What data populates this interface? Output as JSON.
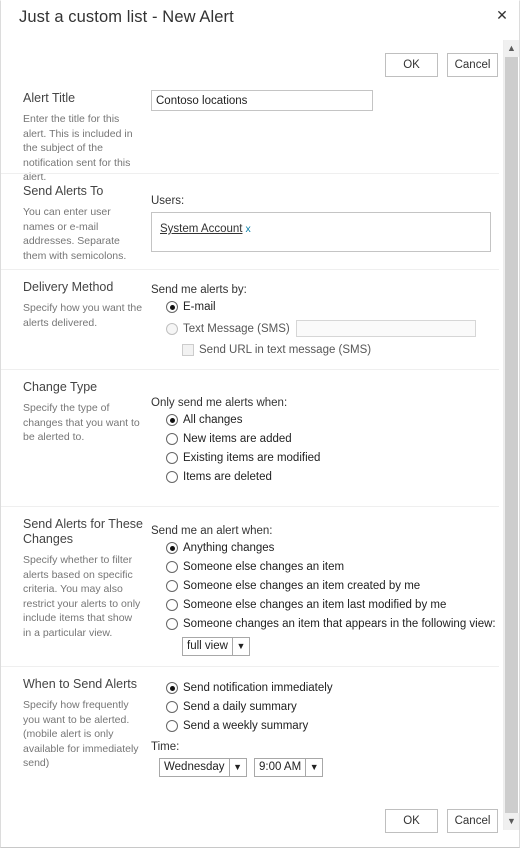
{
  "dialog": {
    "title": "Just a custom list - New Alert",
    "close_icon": "close-icon"
  },
  "actions": {
    "ok_label": "OK",
    "cancel_label": "Cancel"
  },
  "scrollbar": {
    "up_icon": "chevron-up-icon",
    "down_icon": "chevron-down-icon"
  },
  "sections": {
    "alert_title": {
      "title": "Alert Title",
      "description": "Enter the title for this alert. This is included in the subject of the notification sent for this alert.",
      "input_value": "Contoso locations",
      "input_placeholder": ""
    },
    "send_alerts_to": {
      "title": "Send Alerts To",
      "description": "You can enter user names or e-mail addresses. Separate them with semicolons.",
      "users_caption": "Users:",
      "user_name": "System Account",
      "user_remove_label": "x",
      "user_remove_color": "#0b7fa8"
    },
    "delivery_method": {
      "title": "Delivery Method",
      "description": "Specify how you want the alerts delivered.",
      "caption": "Send me alerts by:",
      "options": [
        {
          "label": "E-mail",
          "checked": true,
          "disabled": false
        },
        {
          "label": "Text Message (SMS)",
          "checked": false,
          "disabled": true
        }
      ],
      "sms_input_value": "",
      "sms_checkbox_label": "Send URL in text message (SMS)",
      "sms_checkbox_checked": false
    },
    "change_type": {
      "title": "Change Type",
      "description": "Specify the type of changes that you want to be alerted to.",
      "caption": "Only send me alerts when:",
      "options": [
        {
          "label": "All changes",
          "checked": true
        },
        {
          "label": "New items are added",
          "checked": false
        },
        {
          "label": "Existing items are modified",
          "checked": false
        },
        {
          "label": "Items are deleted",
          "checked": false
        }
      ]
    },
    "send_alerts_for_changes": {
      "title": "Send Alerts for These Changes",
      "description": "Specify whether to filter alerts based on specific criteria. You may also restrict your alerts to only include items that show in a particular view.",
      "caption": "Send me an alert when:",
      "options": [
        {
          "label": "Anything changes",
          "checked": true
        },
        {
          "label": "Someone else changes an item",
          "checked": false
        },
        {
          "label": "Someone else changes an item created by me",
          "checked": false
        },
        {
          "label": "Someone else changes an item last modified by me",
          "checked": false
        },
        {
          "label": "Someone changes an item that appears in the following view:",
          "checked": false
        }
      ],
      "view_select_value": "full view",
      "view_select_arrow": "chevron-down-icon"
    },
    "when_to_send": {
      "title": "When to Send Alerts",
      "description": "Specify how frequently you want to be alerted. (mobile alert is only available for immediately send)",
      "options": [
        {
          "label": "Send notification immediately",
          "checked": true
        },
        {
          "label": "Send a daily summary",
          "checked": false
        },
        {
          "label": "Send a weekly summary",
          "checked": false
        }
      ],
      "time_caption": "Time:",
      "day_value": "Wednesday",
      "time_value": "9:00 AM",
      "day_arrow": "chevron-down-icon",
      "time_arrow": "chevron-down-icon"
    }
  }
}
